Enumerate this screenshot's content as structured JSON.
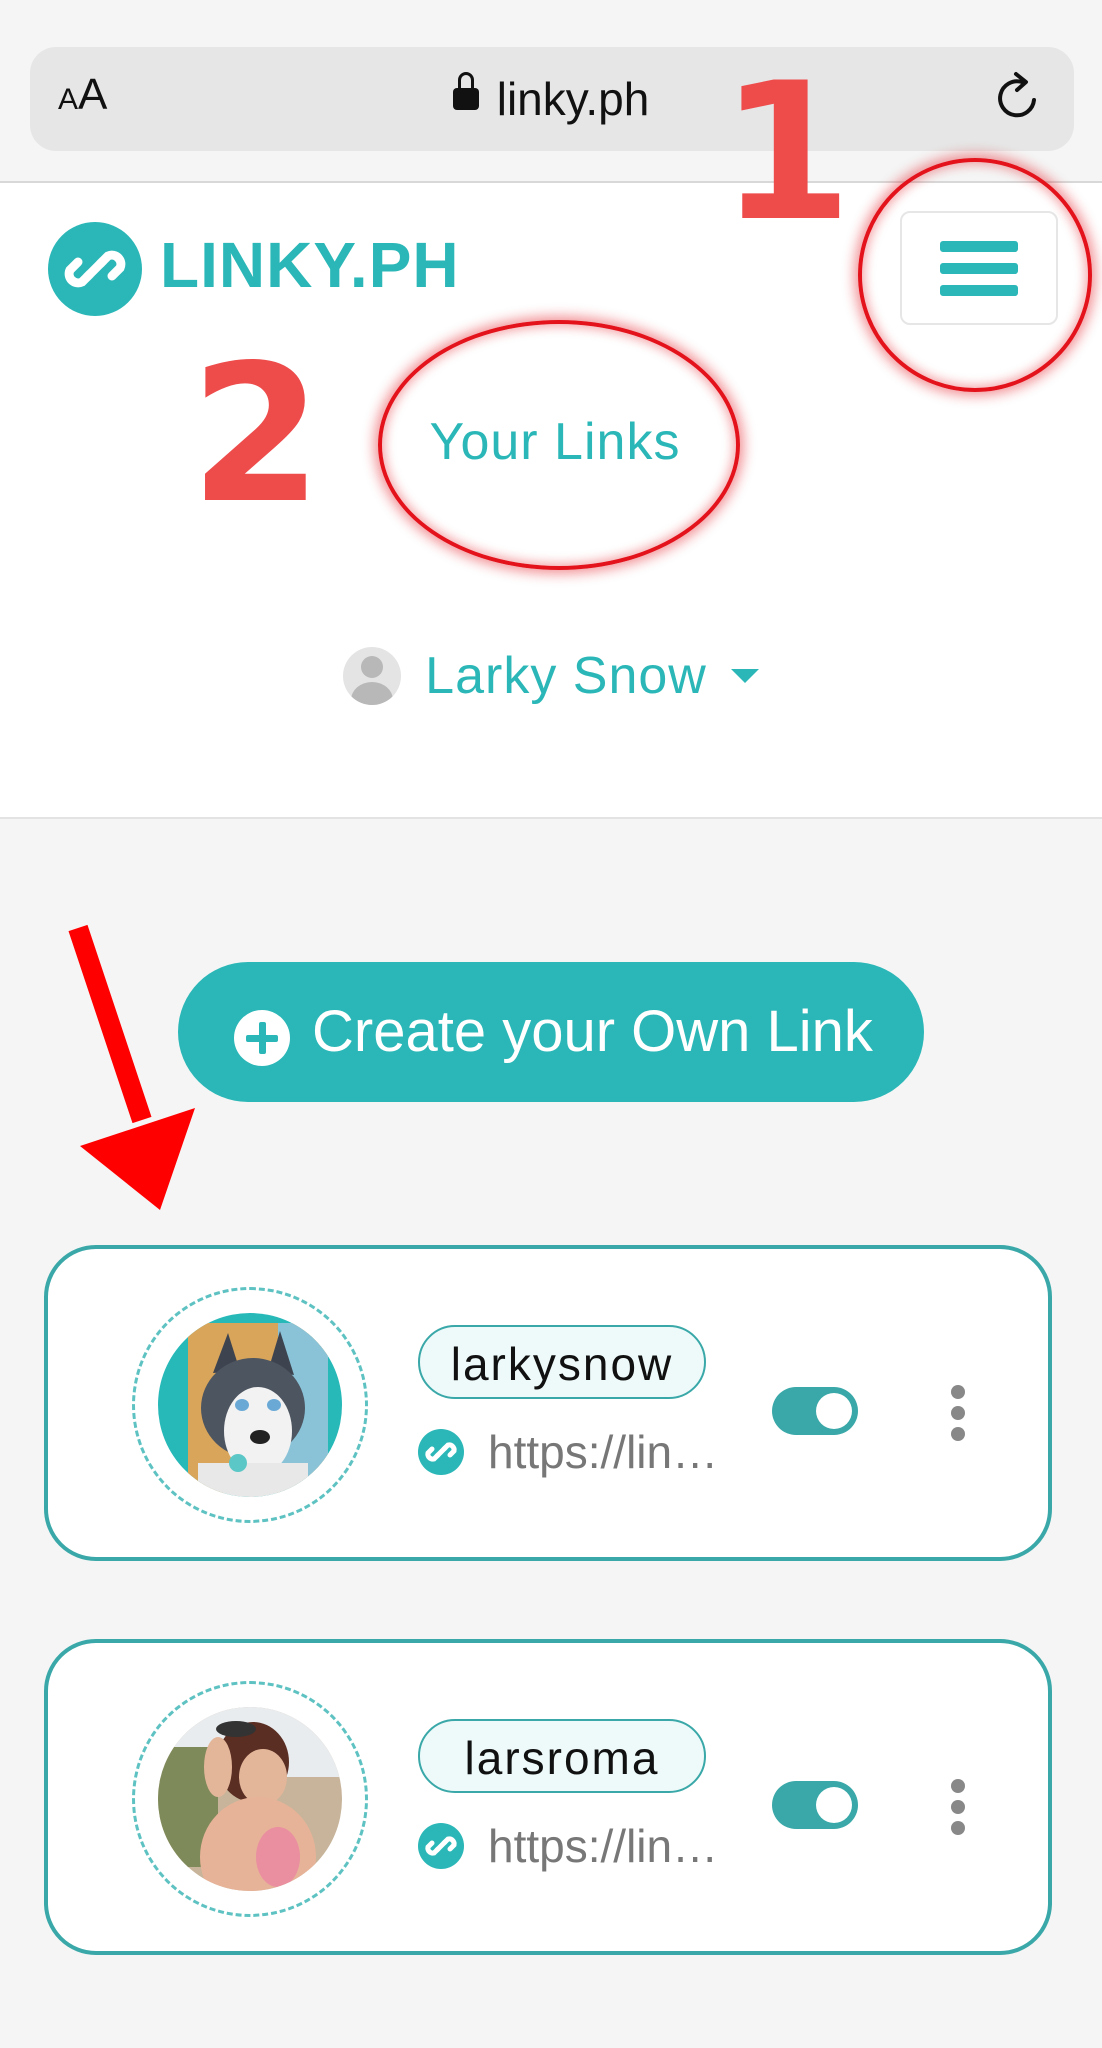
{
  "browser": {
    "aa_label": "AA",
    "url": "linky.ph"
  },
  "header": {
    "logo_text": "LINKY.PH",
    "nav_item": "Your Links",
    "user_name": "Larky Snow"
  },
  "annotations": {
    "step_1": "1",
    "step_2": "2"
  },
  "main": {
    "create_button_label": "Create your Own Link",
    "cards": [
      {
        "handle": "larkysnow",
        "url": "https://lin…",
        "enabled": true
      },
      {
        "handle": "larsroma",
        "url": "https://lin…",
        "enabled": true
      }
    ]
  },
  "colors": {
    "brand": "#2bb7b7",
    "card_border": "#3aa8a8",
    "annotation_red": "#ee4b4b"
  }
}
